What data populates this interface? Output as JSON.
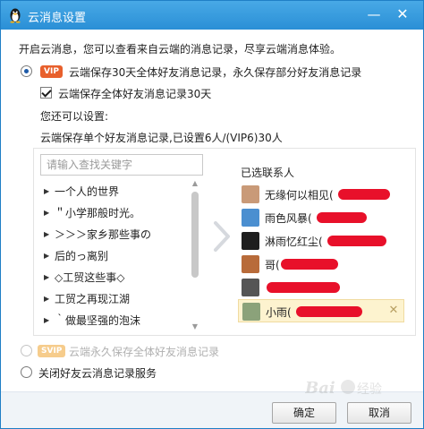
{
  "window": {
    "title": "云消息设置",
    "minimize_glyph": "—",
    "close_glyph": "✕"
  },
  "intro": "开启云消息，您可以查看来自云端的消息记录，尽享云端消息体验。",
  "options": {
    "vip_badge": "VIP",
    "vip_option": "云端保存30天全体好友消息记录，永久保存部分好友消息记录",
    "save_all_checkbox": "云端保存全体好友消息记录30天",
    "you_can_also_set": "您还可以设置:",
    "single_friend_status": "云端保存单个好友消息记录,已设置6人/(VIP6)30人",
    "svip_badge": "SVIP",
    "svip_option": "云端永久保存全体好友消息记录",
    "close_option": "关闭好友云消息记录服务"
  },
  "search": {
    "placeholder": "请输入查找关键字"
  },
  "friend_list": [
    "一个人的世界",
    "＂小学那般时光。",
    "＞＞＞家乡那些事の",
    "后的っ离别",
    "◇工贸这些事◇",
    "工贸之再现江湖",
    "｀做最坚强的泡沫"
  ],
  "selected": {
    "title": "已选联系人",
    "contacts": [
      {
        "name": "无缘何以相见(",
        "avatar_color": "#c99a78"
      },
      {
        "name": "雨色风暴(",
        "avatar_color": "#4b8fd0"
      },
      {
        "name": "淋雨忆红尘(",
        "avatar_color": "#1e1e1e"
      },
      {
        "name": "哥(",
        "avatar_color": "#b86b3a"
      },
      {
        "name": "",
        "avatar_color": "#555555"
      },
      {
        "name": "小雨(",
        "avatar_color": "#8ba27a"
      }
    ],
    "remove_glyph": "✕"
  },
  "buttons": {
    "ok": "确定",
    "cancel": "取消"
  },
  "colors": {
    "titlebar": "#2a8fd6",
    "vip_badge": "#e8602c",
    "svip_badge": "#f0a330",
    "redaction": "#e8102a",
    "active_row": "#fdf3cf"
  }
}
